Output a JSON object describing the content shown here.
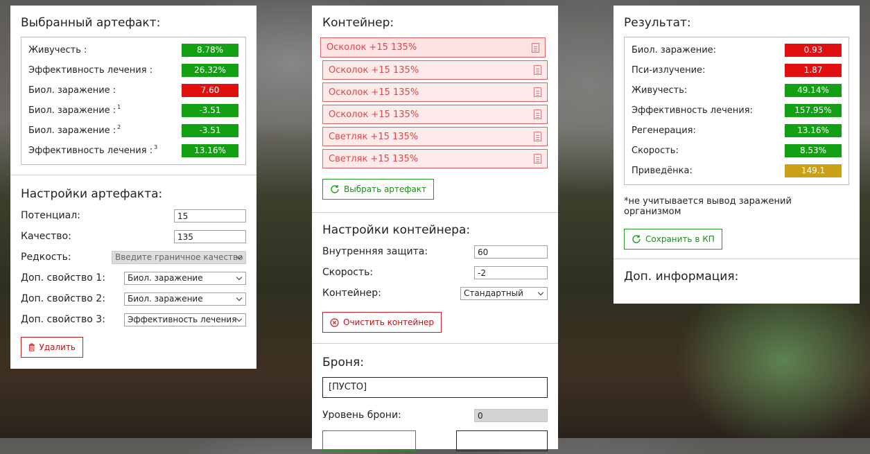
{
  "colors": {
    "green": "#14a014",
    "red": "#e01010",
    "gold": "#c9a016",
    "brand_green": "#1e9a1e",
    "brand_red": "#d01c1c"
  },
  "artifact": {
    "title": "Выбранный артефакт:",
    "stats": [
      {
        "label": "Живучесть :",
        "sup": "",
        "value": "8.78%",
        "color": "green"
      },
      {
        "label": "Эффективность лечения :",
        "sup": "",
        "value": "26.32%",
        "color": "green"
      },
      {
        "label": "Биол. заражение :",
        "sup": "",
        "value": "7.60",
        "color": "red"
      },
      {
        "label": "Биол. заражение :",
        "sup": "1",
        "value": "-3.51",
        "color": "green"
      },
      {
        "label": "Биол. заражение :",
        "sup": "2",
        "value": "-3.51",
        "color": "green"
      },
      {
        "label": "Эффективность лечения :",
        "sup": "3",
        "value": "13.16%",
        "color": "green"
      }
    ]
  },
  "artifact_settings": {
    "title": "Настройки артефакта:",
    "potential_label": "Потенциал:",
    "potential_value": "15",
    "quality_label": "Качество:",
    "quality_value": "135",
    "rarity_label": "Редкость:",
    "rarity_placeholder": "Введите граничное качество",
    "prop1_label": "Доп. свойство 1:",
    "prop1_value": "Биол. заражение",
    "prop2_label": "Доп. свойство 2:",
    "prop2_value": "Биол. заражение",
    "prop3_label": "Доп. свойство 3:",
    "prop3_value": "Эффективность лечения",
    "delete_label": "Удалить"
  },
  "container": {
    "title": "Контейнер:",
    "items": [
      "Осколок +15 135%",
      "Осколок +15 135%",
      "Осколок +15 135%",
      "Осколок +15 135%",
      "Светляк +15 135%",
      "Светляк +15 135%"
    ],
    "choose_label": "Выбрать артефакт"
  },
  "container_settings": {
    "title": "Настройки контейнера:",
    "inner_protection_label": "Внутренняя защита:",
    "inner_protection_value": "60",
    "speed_label": "Скорость:",
    "speed_value": "-2",
    "container_label": "Контейнер:",
    "container_value": "Стандартный",
    "clear_label": "Очистить контейнер"
  },
  "armor": {
    "title": "Броня:",
    "value": "[ПУСТО]",
    "level_label": "Уровень брони:",
    "level_value": "0"
  },
  "result": {
    "title": "Результат:",
    "stats": [
      {
        "label": "Биол. заражение:",
        "value": "0.93",
        "color": "red"
      },
      {
        "label": "Пси-излучение:",
        "value": "1.87",
        "color": "red"
      },
      {
        "label": "Живучесть:",
        "value": "49.14%",
        "color": "green"
      },
      {
        "label": "Эффективность лечения:",
        "value": "157.95%",
        "color": "green"
      },
      {
        "label": "Регенерация:",
        "value": "13.16%",
        "color": "green"
      },
      {
        "label": "Скорость:",
        "value": "8.53%",
        "color": "green"
      },
      {
        "label": "Приведёнка:",
        "value": "149.1",
        "color": "gold"
      }
    ],
    "note": "*не учитывается вывод заражений организмом",
    "save_label": "Сохранить в КП"
  },
  "extra": {
    "title": "Доп. информация:"
  }
}
